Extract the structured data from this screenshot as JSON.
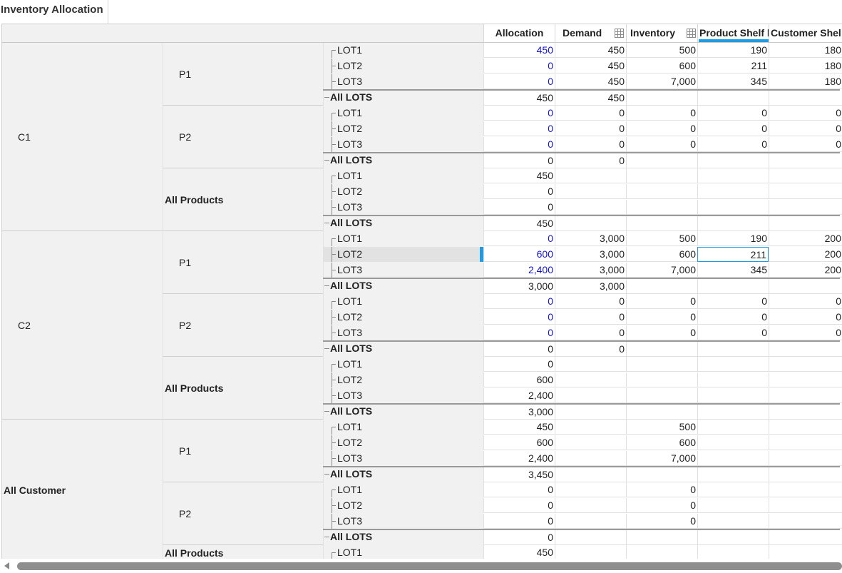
{
  "tab": {
    "title": "Inventory Allocation"
  },
  "columns": [
    "Allocation",
    "Demand",
    "Inventory",
    "Product Shelf l",
    "Customer Shel"
  ],
  "row_groups": [
    {
      "customer": "C1",
      "products": [
        {
          "name": "P1",
          "type": "product",
          "lots": [
            {
              "lot": "LOT1",
              "values": [
                "450",
                "450",
                "500",
                "190",
                "180"
              ],
              "blue": true
            },
            {
              "lot": "LOT2",
              "values": [
                "0",
                "450",
                "600",
                "211",
                "180"
              ],
              "blue": true
            },
            {
              "lot": "LOT3",
              "values": [
                "0",
                "450",
                "7,000",
                "345",
                "180"
              ],
              "blue": true
            },
            {
              "lot": "All LOTS",
              "values": [
                "450",
                "450",
                "",
                "",
                ""
              ]
            }
          ]
        },
        {
          "name": "P2",
          "type": "product",
          "lots": [
            {
              "lot": "LOT1",
              "values": [
                "0",
                "0",
                "0",
                "0",
                "0"
              ],
              "blue": true
            },
            {
              "lot": "LOT2",
              "values": [
                "0",
                "0",
                "0",
                "0",
                "0"
              ],
              "blue": true
            },
            {
              "lot": "LOT3",
              "values": [
                "0",
                "0",
                "0",
                "0",
                "0"
              ],
              "blue": true
            },
            {
              "lot": "All LOTS",
              "values": [
                "0",
                "0",
                "",
                "",
                ""
              ]
            }
          ]
        },
        {
          "name": "All Products",
          "type": "total",
          "lots": [
            {
              "lot": "LOT1",
              "values": [
                "450",
                "",
                "",
                "",
                ""
              ]
            },
            {
              "lot": "LOT2",
              "values": [
                "0",
                "",
                "",
                "",
                ""
              ]
            },
            {
              "lot": "LOT3",
              "values": [
                "0",
                "",
                "",
                "",
                ""
              ]
            },
            {
              "lot": "All LOTS",
              "values": [
                "450",
                "",
                "",
                "",
                ""
              ]
            }
          ]
        }
      ]
    },
    {
      "customer": "C2",
      "products": [
        {
          "name": "P1",
          "type": "product",
          "lots": [
            {
              "lot": "LOT1",
              "values": [
                "0",
                "3,000",
                "500",
                "190",
                "200"
              ],
              "blue": true
            },
            {
              "lot": "LOT2",
              "values": [
                "600",
                "3,000",
                "600",
                "211",
                "200"
              ],
              "blue": true,
              "selected": true
            },
            {
              "lot": "LOT3",
              "values": [
                "2,400",
                "3,000",
                "7,000",
                "345",
                "200"
              ],
              "blue": true
            },
            {
              "lot": "All LOTS",
              "values": [
                "3,000",
                "3,000",
                "",
                "",
                ""
              ]
            }
          ]
        },
        {
          "name": "P2",
          "type": "product",
          "lots": [
            {
              "lot": "LOT1",
              "values": [
                "0",
                "0",
                "0",
                "0",
                "0"
              ],
              "blue": true
            },
            {
              "lot": "LOT2",
              "values": [
                "0",
                "0",
                "0",
                "0",
                "0"
              ],
              "blue": true
            },
            {
              "lot": "LOT3",
              "values": [
                "0",
                "0",
                "0",
                "0",
                "0"
              ],
              "blue": true
            },
            {
              "lot": "All LOTS",
              "values": [
                "0",
                "0",
                "",
                "",
                ""
              ]
            }
          ]
        },
        {
          "name": "All Products",
          "type": "total",
          "lots": [
            {
              "lot": "LOT1",
              "values": [
                "0",
                "",
                "",
                "",
                ""
              ]
            },
            {
              "lot": "LOT2",
              "values": [
                "600",
                "",
                "",
                "",
                ""
              ]
            },
            {
              "lot": "LOT3",
              "values": [
                "2,400",
                "",
                "",
                "",
                ""
              ]
            },
            {
              "lot": "All LOTS",
              "values": [
                "3,000",
                "",
                "",
                "",
                ""
              ]
            }
          ]
        }
      ]
    },
    {
      "customer": "All Customer",
      "products": [
        {
          "name": "P1",
          "type": "product",
          "lots": [
            {
              "lot": "LOT1",
              "values": [
                "450",
                "",
                "500",
                "",
                ""
              ]
            },
            {
              "lot": "LOT2",
              "values": [
                "600",
                "",
                "600",
                "",
                ""
              ]
            },
            {
              "lot": "LOT3",
              "values": [
                "2,400",
                "",
                "7,000",
                "",
                ""
              ]
            },
            {
              "lot": "All LOTS",
              "values": [
                "3,450",
                "",
                "",
                "",
                ""
              ]
            }
          ]
        },
        {
          "name": "P2",
          "type": "product",
          "lots": [
            {
              "lot": "LOT1",
              "values": [
                "0",
                "",
                "0",
                "",
                ""
              ]
            },
            {
              "lot": "LOT2",
              "values": [
                "0",
                "",
                "0",
                "",
                ""
              ]
            },
            {
              "lot": "LOT3",
              "values": [
                "0",
                "",
                "0",
                "",
                ""
              ]
            },
            {
              "lot": "All LOTS",
              "values": [
                "0",
                "",
                "",
                "",
                ""
              ]
            }
          ]
        },
        {
          "name": "All Products",
          "type": "total",
          "lots": [
            {
              "lot": "LOT1",
              "values": [
                "450",
                "",
                "",
                "",
                ""
              ]
            }
          ]
        }
      ]
    }
  ],
  "focused_cell": {
    "customer": "C2",
    "product": "P1",
    "lot": "LOT2",
    "column": "Product Shelf l"
  },
  "colors": {
    "accent": "#1e9be3",
    "editable_value": "#1313d8",
    "header_bg": "#f1f1f1"
  }
}
